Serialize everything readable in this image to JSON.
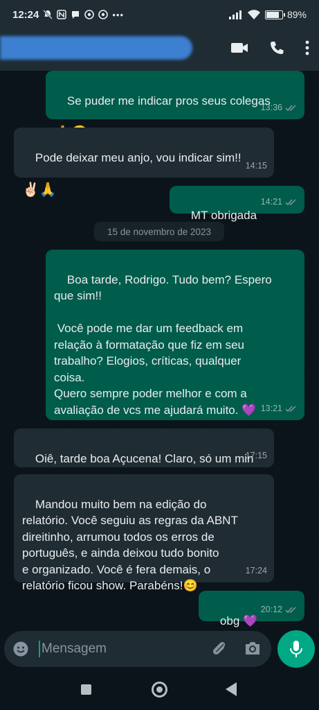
{
  "status_bar": {
    "time": "12:24",
    "battery": "89%",
    "battery_level": 0.89
  },
  "app_bar": {
    "contact_name_redacted": true,
    "icons": [
      "video-call-icon",
      "phone-icon",
      "more-vert-icon"
    ]
  },
  "messages": [
    {
      "dir": "out",
      "text": "Se puder me indicar pros seus colegas",
      "emoji": "🙏😍",
      "time": "13:36",
      "read": true
    },
    {
      "dir": "in",
      "text": "Pode deixar meu anjo, vou indicar sim!!",
      "emoji": "✌🏻🙏",
      "time": "14:15"
    },
    {
      "dir": "out",
      "text": "MT obrigada",
      "time": "14:21",
      "read": true
    },
    {
      "dir": "out",
      "text": "Boa tarde, Rodrigo. Tudo bem? Espero\nque sim!!\n\n Você pode me dar um feedback em\nrelação à formatação que fiz em seu\ntrabalho? Elogios, críticas, qualquer\ncoisa.\nQuero sempre poder melhor e com a\navaliação de vcs me ajudará muito. 💜",
      "time": "13:21",
      "read": true
    },
    {
      "dir": "in",
      "text": "Oiê, tarde boa Açucena! Claro, só um min",
      "time": "17:15"
    },
    {
      "dir": "in",
      "text": "Mandou muito bem na edição do\nrelatório. Você seguiu as regras da ABNT\ndireitinho, arrumou todos os erros de\nportuguês, e ainda deixou tudo bonito\ne organizado. Você é fera demais, o\nrelatório ficou show. Parabéns!😊",
      "time": "17:24"
    },
    {
      "dir": "out",
      "text": "obg 💜",
      "time": "20:12",
      "read": true
    }
  ],
  "date_divider": "15 de novembro de 2023",
  "composer": {
    "placeholder": "Mensagem"
  },
  "colors": {
    "outgoing_bubble": "#005c4b",
    "incoming_bubble": "#202c33",
    "accent": "#00a884",
    "read_ticks": "#8696a0"
  }
}
